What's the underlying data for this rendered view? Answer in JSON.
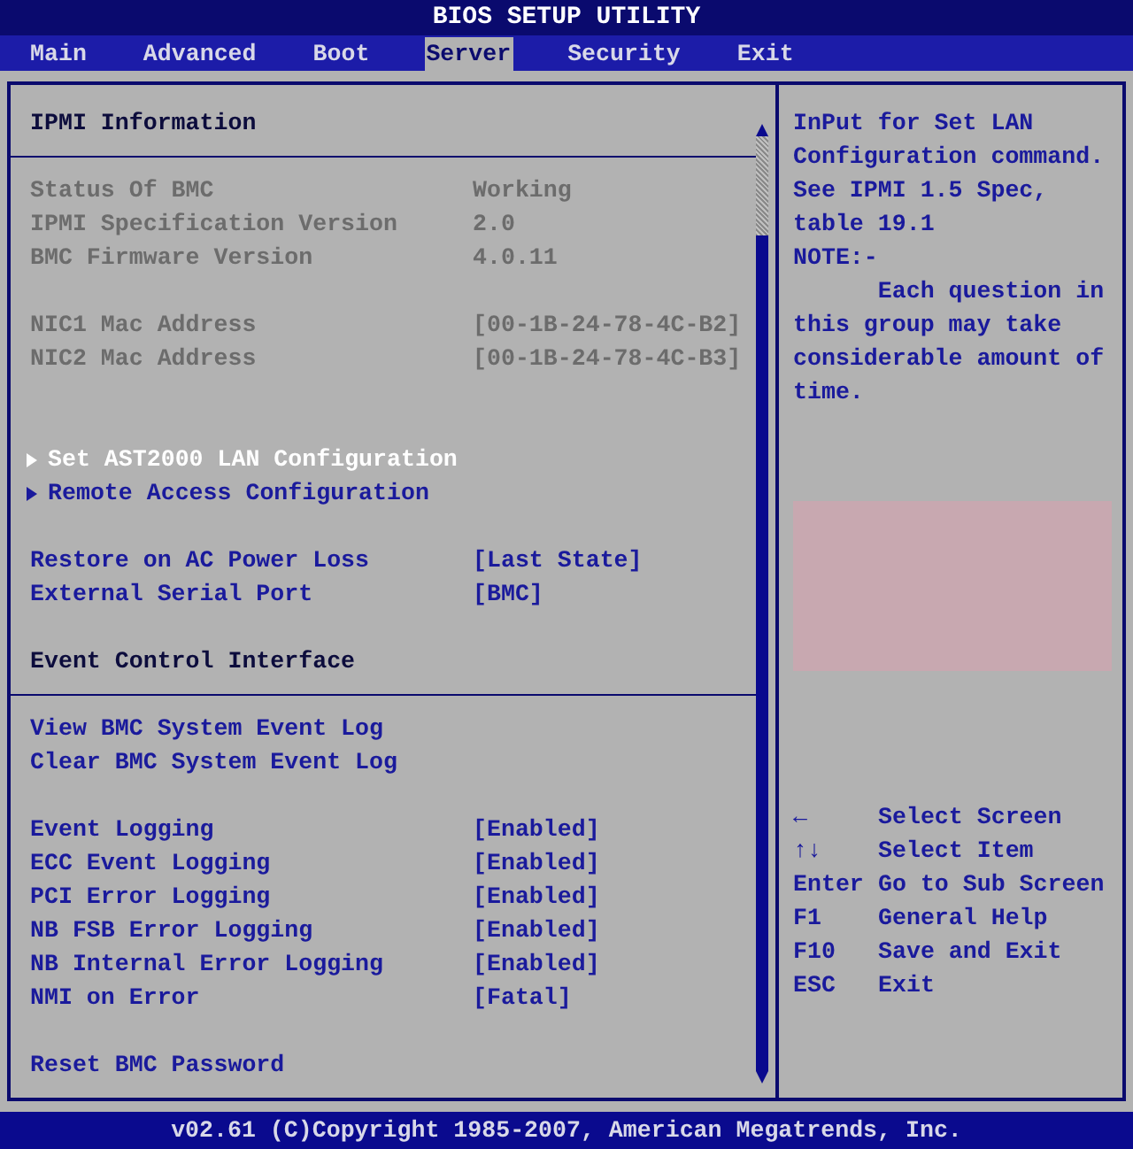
{
  "window": {
    "title": "BIOS SETUP UTILITY"
  },
  "tabs": [
    {
      "label": "Main",
      "selected": false
    },
    {
      "label": "Advanced",
      "selected": false
    },
    {
      "label": "Boot",
      "selected": false
    },
    {
      "label": "Server",
      "selected": true
    },
    {
      "label": "Security",
      "selected": false
    },
    {
      "label": "Exit",
      "selected": false
    }
  ],
  "sections": [
    {
      "items": [
        {
          "kind": "heading",
          "label": "IPMI Information"
        }
      ]
    },
    {
      "items": [
        {
          "kind": "info",
          "label": "Status Of BMC",
          "value": "Working"
        },
        {
          "kind": "info",
          "label": "IPMI Specification Version",
          "value": "2.0"
        },
        {
          "kind": "info",
          "label": "BMC Firmware Version",
          "value": "4.0.11"
        }
      ]
    },
    {
      "items": [
        {
          "kind": "info",
          "label": "NIC1 Mac Address",
          "value": "[00-1B-24-78-4C-B2]"
        },
        {
          "kind": "info",
          "label": "NIC2 Mac Address",
          "value": "[00-1B-24-78-4C-B3]"
        }
      ]
    },
    {
      "items": [
        {
          "kind": "submenu",
          "label": "Set AST2000 LAN Configuration",
          "selected": true
        },
        {
          "kind": "submenu",
          "label": "Remote Access Configuration",
          "selected": false
        }
      ]
    },
    {
      "items": [
        {
          "kind": "option",
          "label": "Restore on AC Power Loss",
          "value": "[Last State]"
        },
        {
          "kind": "option",
          "label": "External Serial Port",
          "value": "[BMC]"
        }
      ]
    },
    {
      "items": [
        {
          "kind": "heading",
          "label": "Event Control Interface"
        }
      ]
    },
    {
      "items": [
        {
          "kind": "action",
          "label": "View BMC System Event Log"
        },
        {
          "kind": "action",
          "label": "Clear BMC System Event Log"
        }
      ]
    },
    {
      "items": [
        {
          "kind": "option",
          "label": "Event Logging",
          "value": "[Enabled]"
        },
        {
          "kind": "option",
          "label": "ECC Event Logging",
          "value": "[Enabled]"
        },
        {
          "kind": "option",
          "label": "PCI Error Logging",
          "value": "[Enabled]"
        },
        {
          "kind": "option",
          "label": "NB FSB Error Logging",
          "value": "[Enabled]"
        },
        {
          "kind": "option",
          "label": "NB Internal Error Logging",
          "value": "[Enabled]"
        },
        {
          "kind": "option",
          "label": "NMI on Error",
          "value": "[Fatal]"
        }
      ]
    },
    {
      "items": [
        {
          "kind": "action",
          "label": "Reset BMC Password"
        }
      ]
    }
  ],
  "help": {
    "lines": [
      "InPut for Set LAN",
      "Configuration command.",
      "See IPMI 1.5 Spec,",
      "table 19.1",
      "NOTE:-",
      "      Each question in",
      "this group may take",
      "considerable amount of",
      "time."
    ],
    "keys": [
      {
        "key": "←",
        "action": "Select Screen"
      },
      {
        "key": "↑↓",
        "action": "Select Item"
      },
      {
        "key": "Enter",
        "action": "Go to Sub Screen"
      },
      {
        "key": "F1",
        "action": "General Help"
      },
      {
        "key": "F10",
        "action": "Save and Exit"
      },
      {
        "key": "ESC",
        "action": "Exit"
      }
    ]
  },
  "status_bar": "v02.61 (C)Copyright 1985-2007, American Megatrends, Inc."
}
